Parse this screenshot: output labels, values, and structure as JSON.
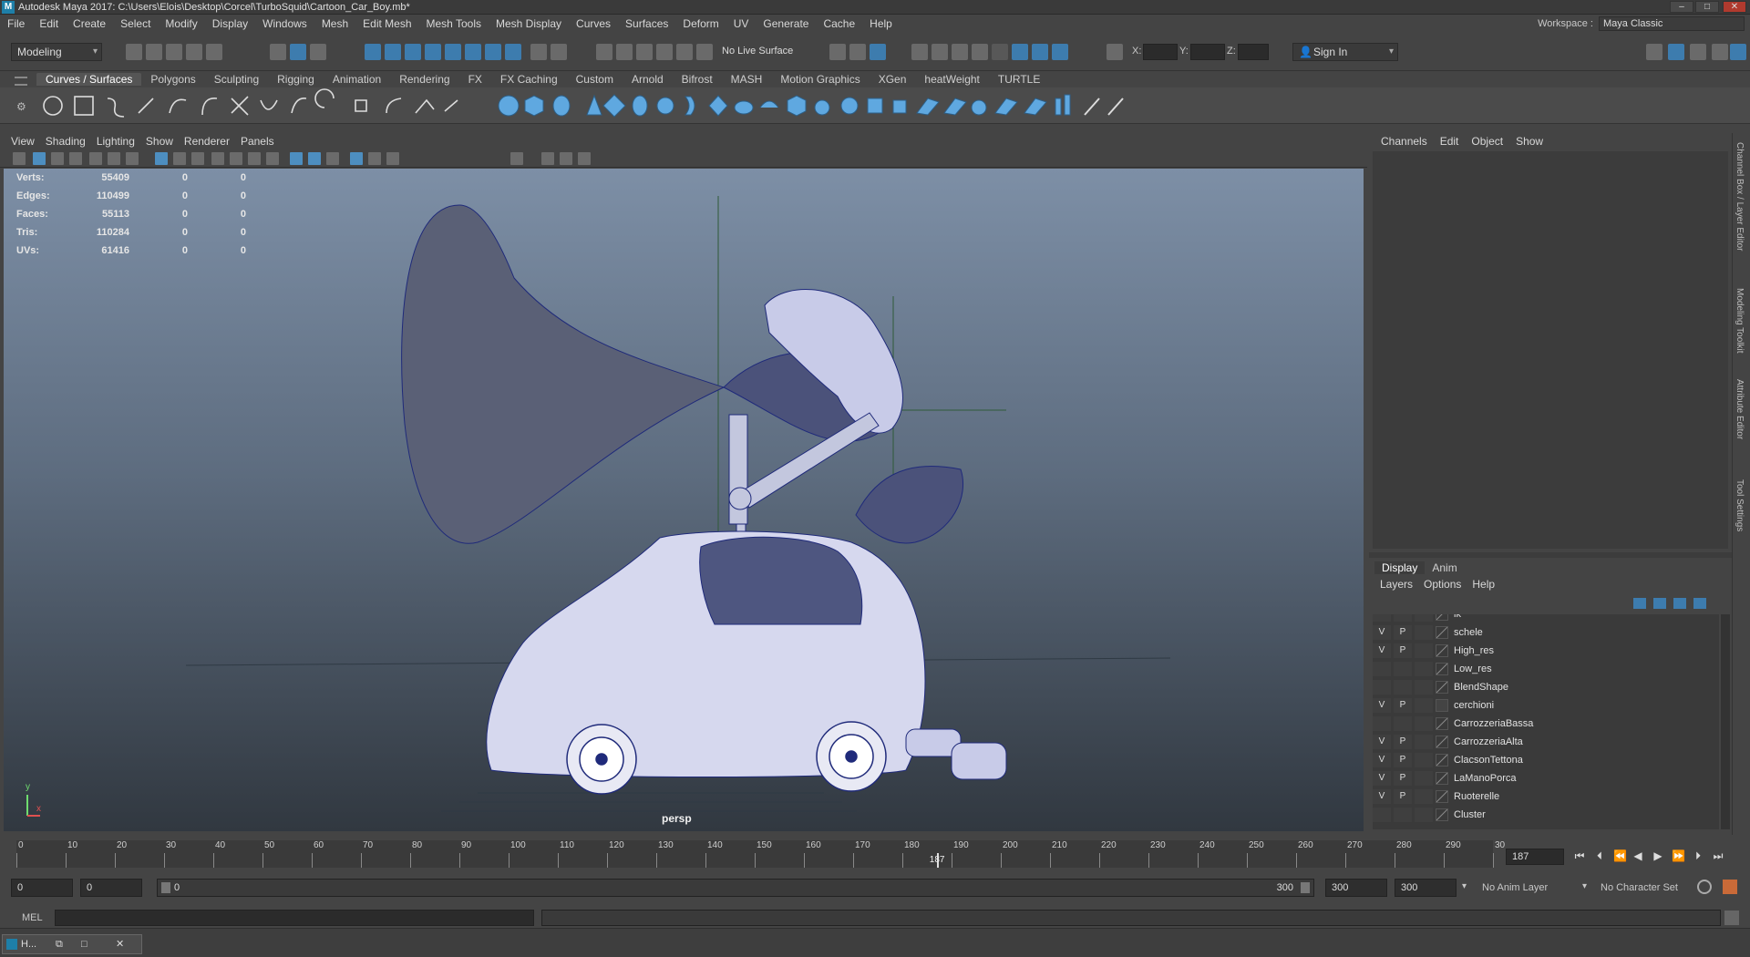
{
  "window": {
    "title": "Autodesk Maya 2017: C:\\Users\\Elois\\Desktop\\Corcel\\TurboSquid\\Cartoon_Car_Boy.mb*"
  },
  "menubar": {
    "items": [
      "File",
      "Edit",
      "Create",
      "Select",
      "Modify",
      "Display",
      "Windows",
      "Mesh",
      "Edit Mesh",
      "Mesh Tools",
      "Mesh Display",
      "Curves",
      "Surfaces",
      "Deform",
      "UV",
      "Generate",
      "Cache",
      "Help"
    ]
  },
  "workspace": {
    "label": "Workspace :",
    "value": "Maya Classic"
  },
  "statusline": {
    "mode": "Modeling",
    "live_surface": "No Live Surface",
    "x_label": "X:",
    "y_label": "Y:",
    "z_label": "Z:",
    "sign_in": "Sign In"
  },
  "shelf": {
    "tabs": [
      "Curves / Surfaces",
      "Polygons",
      "Sculpting",
      "Rigging",
      "Animation",
      "Rendering",
      "FX",
      "FX Caching",
      "Custom",
      "Arnold",
      "Bifrost",
      "MASH",
      "Motion Graphics",
      "XGen",
      "heatWeight",
      "TURTLE"
    ],
    "active": "Curves / Surfaces"
  },
  "viewport": {
    "menu": [
      "View",
      "Shading",
      "Lighting",
      "Show",
      "Renderer",
      "Panels"
    ],
    "camera_label": "persp",
    "hud": [
      {
        "key": "Verts:",
        "value": "55409",
        "a": "0",
        "b": "0"
      },
      {
        "key": "Edges:",
        "value": "110499",
        "a": "0",
        "b": "0"
      },
      {
        "key": "Faces:",
        "value": "55113",
        "a": "0",
        "b": "0"
      },
      {
        "key": "Tris:",
        "value": "110284",
        "a": "0",
        "b": "0"
      },
      {
        "key": "UVs:",
        "value": "61416",
        "a": "0",
        "b": "0"
      }
    ],
    "axis_y": "y",
    "axis_x": "x"
  },
  "channel_box": {
    "menu": [
      "Channels",
      "Edit",
      "Object",
      "Show"
    ]
  },
  "side_tabs": [
    "Channel Box / Layer Editor",
    "Modeling Toolkit",
    "Attribute Editor",
    "Tool Settings"
  ],
  "layer_editor": {
    "tabs": [
      "Display",
      "Anim"
    ],
    "active_tab": "Display",
    "menu": [
      "Layers",
      "Options",
      "Help"
    ],
    "layers": [
      {
        "v": "",
        "p": "",
        "name": "ik"
      },
      {
        "v": "V",
        "p": "P",
        "name": "schele"
      },
      {
        "v": "V",
        "p": "P",
        "name": "High_res"
      },
      {
        "v": "",
        "p": "",
        "name": "Low_res"
      },
      {
        "v": "",
        "p": "",
        "name": "BlendShape"
      },
      {
        "v": "V",
        "p": "P",
        "name": "cerchioni"
      },
      {
        "v": "",
        "p": "",
        "name": "CarrozzeriaBassa"
      },
      {
        "v": "V",
        "p": "P",
        "name": "CarrozzeriaAlta"
      },
      {
        "v": "V",
        "p": "P",
        "name": "ClacsonTettona"
      },
      {
        "v": "V",
        "p": "P",
        "name": "LaManoPorca"
      },
      {
        "v": "V",
        "p": "P",
        "name": "Ruoterelle"
      },
      {
        "v": "",
        "p": "",
        "name": "Cluster"
      }
    ]
  },
  "timeline": {
    "ticks": [
      "0",
      "10",
      "20",
      "30",
      "40",
      "50",
      "60",
      "70",
      "80",
      "90",
      "100",
      "110",
      "120",
      "130",
      "140",
      "150",
      "160",
      "170",
      "180",
      "190",
      "200",
      "210",
      "220",
      "230",
      "240",
      "250",
      "260",
      "270",
      "280",
      "290",
      "30"
    ],
    "playhead_label": "187",
    "current_frame": "187"
  },
  "range": {
    "start": "0",
    "anim_start": "0",
    "slider_start": "0",
    "slider_end": "300",
    "anim_end": "300",
    "end": "300",
    "anim_layer": "No Anim Layer",
    "character_set": "No Character Set"
  },
  "cmdline": {
    "label": "MEL"
  },
  "taskbar": {
    "item": "H..."
  }
}
